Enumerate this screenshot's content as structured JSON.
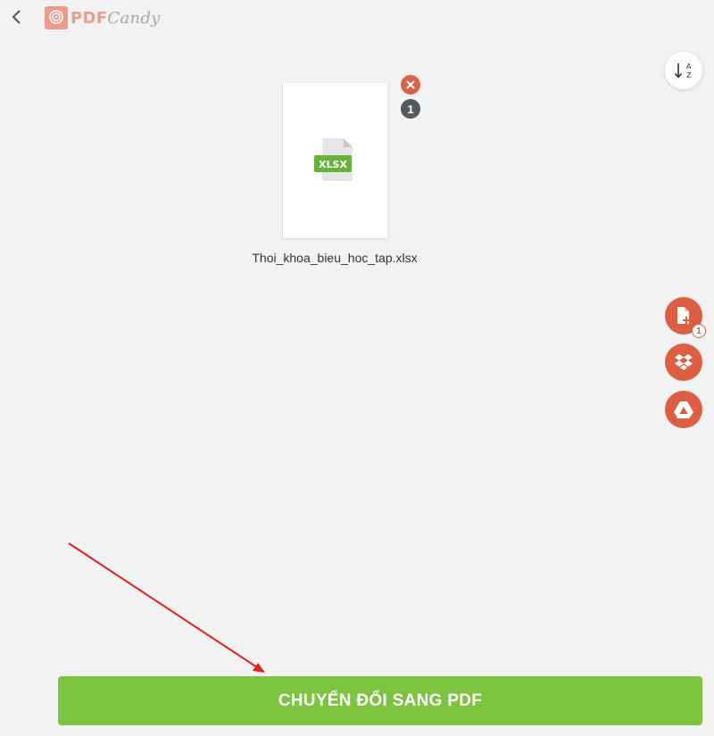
{
  "header": {
    "back_icon": "chevron-left-icon",
    "logo": {
      "brand_pdf": "PDF",
      "brand_candy": "Candy",
      "brand_color": "#e79e90"
    }
  },
  "toolbar": {
    "sort_icon": "sort-az-icon"
  },
  "file": {
    "name": "Thoi_khoa_bieu_hoc_tap.xlsx",
    "type_label": "XLSX",
    "page_count": "1",
    "remove_icon": "close-icon"
  },
  "side_actions": {
    "add_file_badge": "1",
    "add_file_icon": "add-file-icon",
    "dropbox_icon": "dropbox-icon",
    "google_drive_icon": "google-drive-icon",
    "accent_color": "#dc5e43"
  },
  "convert_button": {
    "label": "CHUYỂN ĐỔI SANG PDF",
    "color": "#7cc340"
  },
  "annotation": {
    "arrow_color": "#e02020"
  }
}
